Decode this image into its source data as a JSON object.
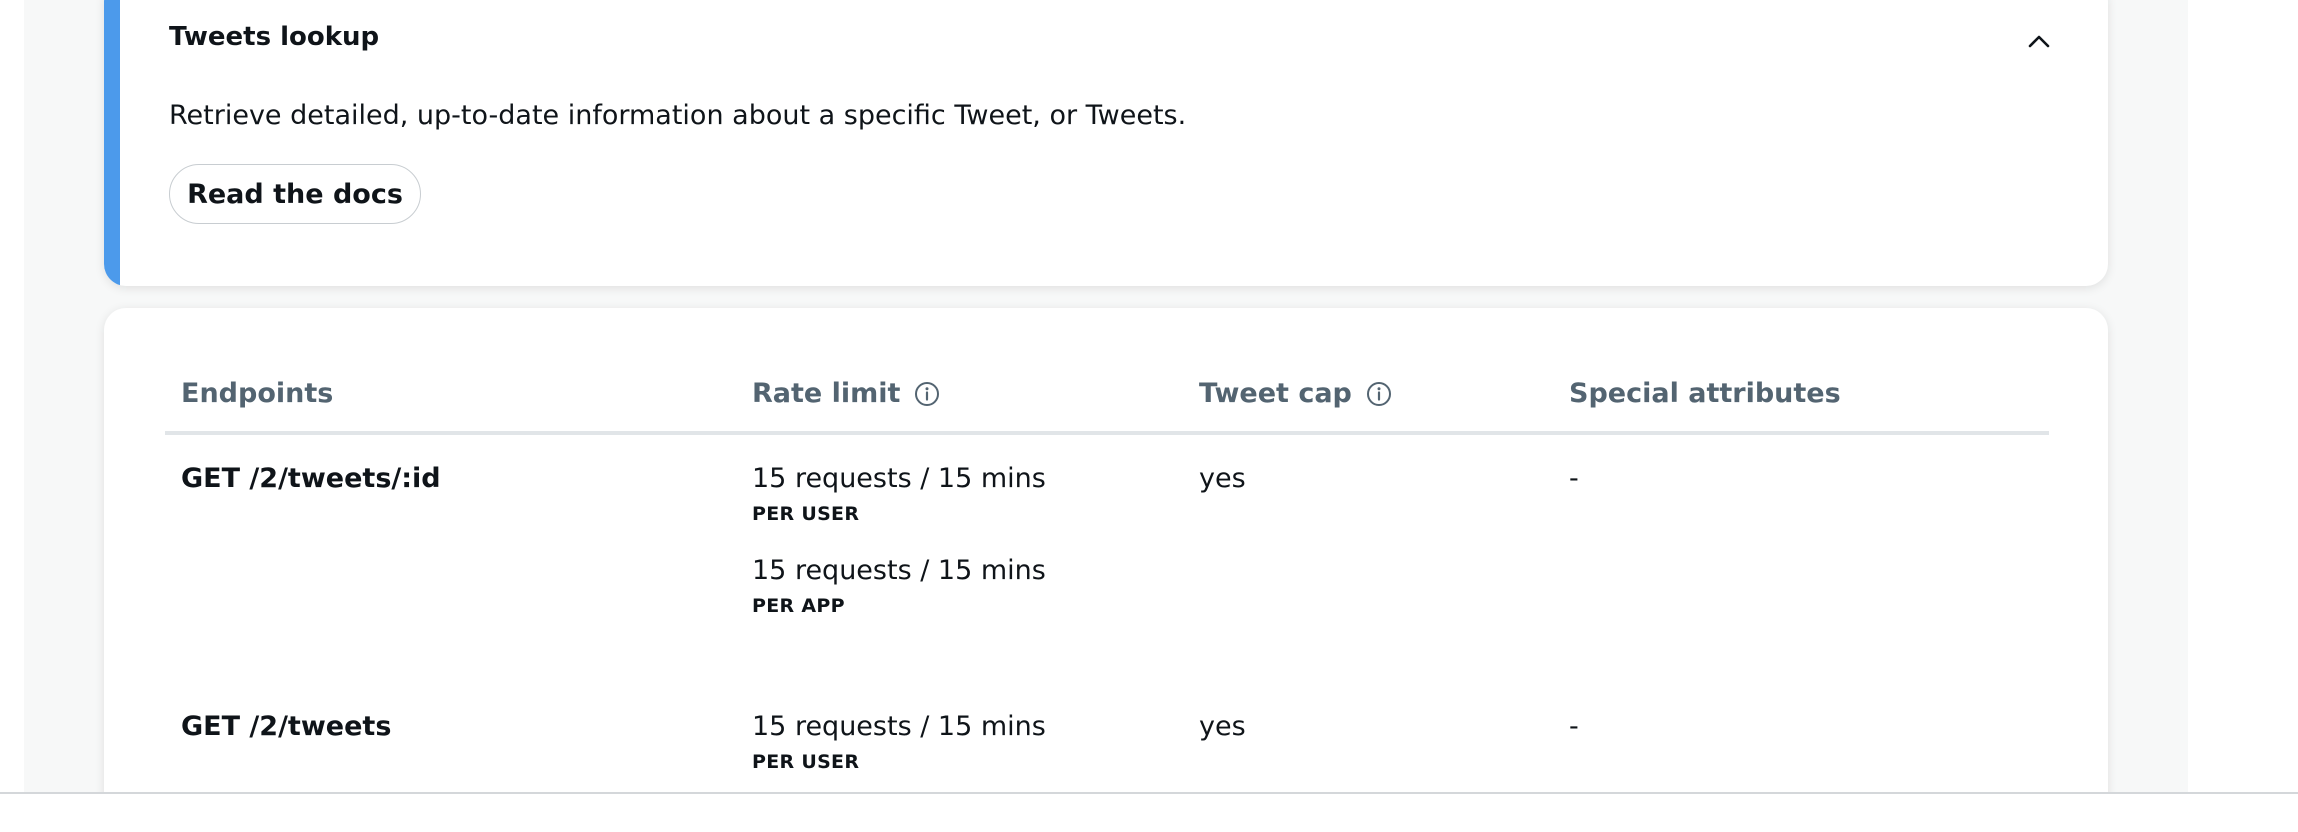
{
  "section": {
    "title": "Tweets lookup",
    "description": "Retrieve detailed, up-to-date information about a specific Tweet, or Tweets.",
    "docs_button_label": "Read the docs",
    "accent_color": "#4c9aeb"
  },
  "table": {
    "headers": {
      "endpoints": "Endpoints",
      "rate_limit": "Rate limit",
      "tweet_cap": "Tweet cap",
      "special_attributes": "Special attributes"
    },
    "rows": [
      {
        "endpoint": "GET /2/tweets/:id",
        "rate_limits": [
          {
            "value": "15 requests / 15 mins",
            "scope": "PER USER"
          },
          {
            "value": "15 requests / 15 mins",
            "scope": "PER APP"
          }
        ],
        "tweet_cap": "yes",
        "special_attributes": "-"
      },
      {
        "endpoint": "GET /2/tweets",
        "rate_limits": [
          {
            "value": "15 requests / 15 mins",
            "scope": "PER USER"
          }
        ],
        "tweet_cap": "yes",
        "special_attributes": "-"
      }
    ]
  },
  "icons": {
    "collapse": "chevron-up-icon",
    "info": "info-circle-icon"
  }
}
